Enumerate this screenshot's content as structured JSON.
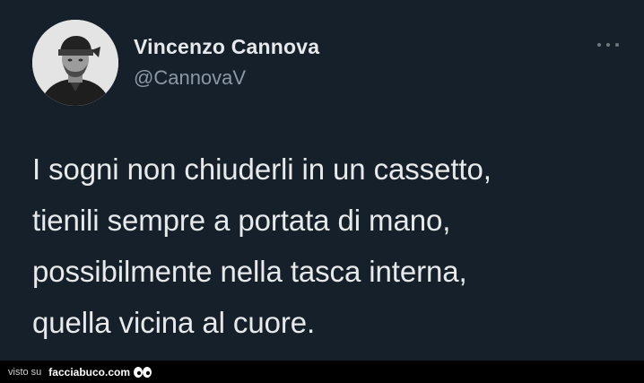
{
  "tweet": {
    "display_name": "Vincenzo Cannova",
    "handle": "@CannovaV",
    "more_icon": "ellipsis-icon",
    "text_lines": [
      "I sogni non chiuderli in un cassetto,",
      "tienili sempre a portata di mano,",
      "possibilmente nella tasca interna,",
      "quella vicina al cuore."
    ]
  },
  "footer": {
    "prefix": "visto su",
    "site": "facciabuco.com",
    "logo_icon": "eyes-icon"
  },
  "colors": {
    "background": "#15202b",
    "text": "#e7e9ea",
    "secondary_text": "#8b98a5",
    "footer_background": "#000000"
  }
}
